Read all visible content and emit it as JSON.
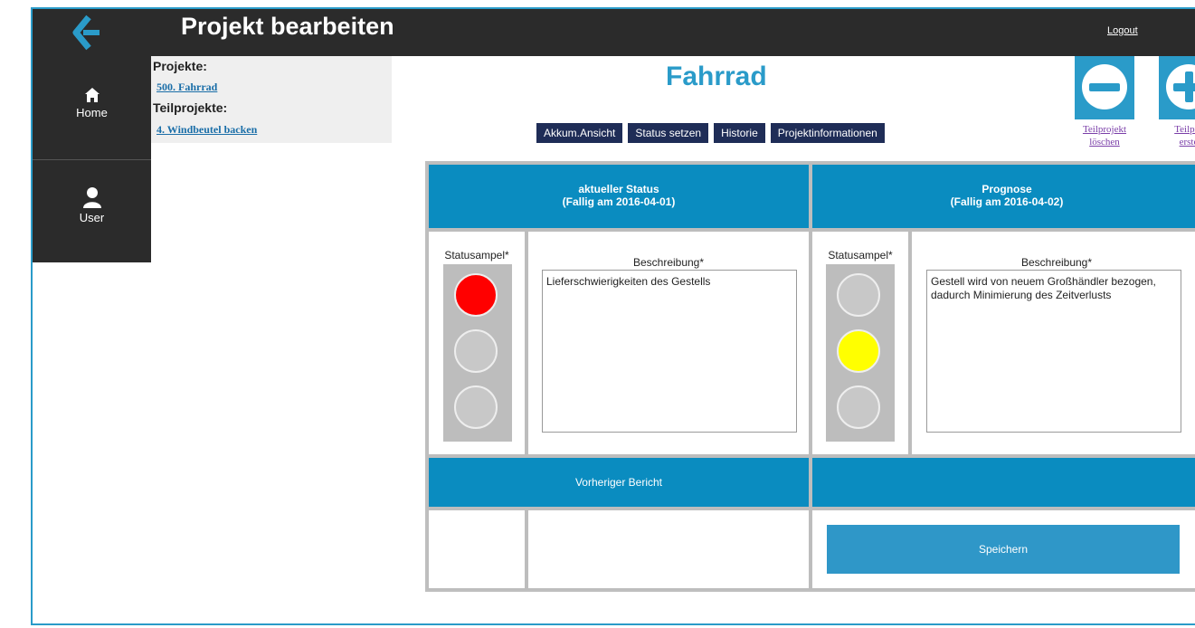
{
  "app": {
    "title": "Projekt bearbeiten",
    "logout_label": "Logout"
  },
  "sidebar": {
    "items": [
      {
        "label": "Home",
        "icon": "home-icon"
      },
      {
        "label": "User",
        "icon": "user-icon"
      }
    ]
  },
  "projects": {
    "projects_heading": "Projekte:",
    "project_link": "500. Fahrrad",
    "subprojects_heading": "Teilprojekte:",
    "subproject_link": "4. Windbeutel backen"
  },
  "project": {
    "name": "Fahrrad"
  },
  "nav": {
    "tabs": [
      "Akkum.Ansicht",
      "Status setzen",
      "Historie",
      "Projektinformationen"
    ]
  },
  "actions": {
    "delete": {
      "line1": "Teilprojekt",
      "line2": "löschen"
    },
    "create": {
      "line1": "Teilpro",
      "line2": "erste"
    }
  },
  "current": {
    "title": "aktueller Status",
    "due": "(Fallig am 2016-04-01)",
    "light_label": "Statusampel*",
    "desc_label": "Beschreibung*",
    "description": "Lieferschwierigkeiten des Gestells",
    "light": "red"
  },
  "forecast": {
    "title": "Prognose",
    "due": "(Fallig am 2016-04-02)",
    "light_label": "Statusampel*",
    "desc_label": "Beschreibung*",
    "description": "Gestell wird von neuem Großhändler bezogen, dadurch Minimierung des Zeitverlusts",
    "light": "yellow"
  },
  "previous": {
    "label": "Vorheriger Bericht"
  },
  "save": {
    "label": "Speichern"
  },
  "colors": {
    "accent": "#0a8cc0",
    "nav": "#1f2d57",
    "dark": "#2b2b2b",
    "red": "#ff0000",
    "yellow": "#ffff00",
    "off": "#c8c8c8"
  }
}
